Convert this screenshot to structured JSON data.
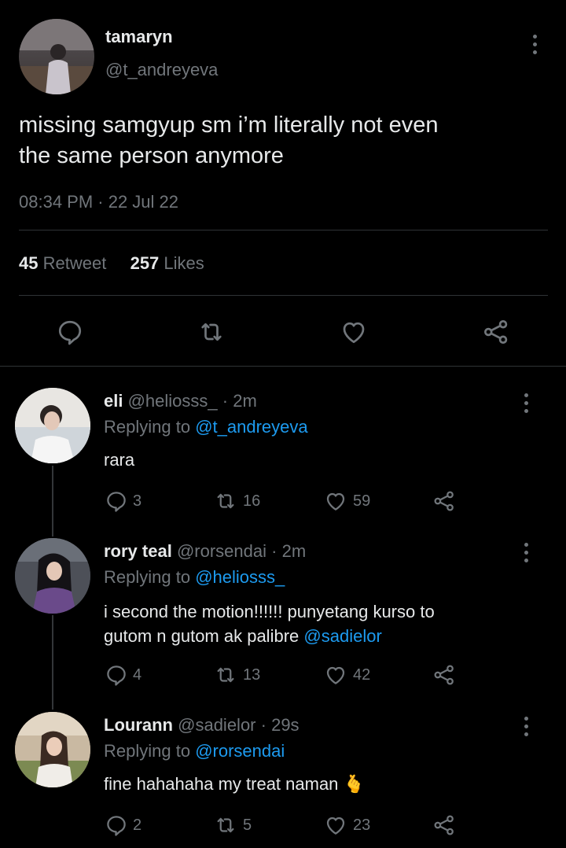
{
  "main_tweet": {
    "display_name": "tamaryn",
    "handle": "@t_andreyeva",
    "text_line1": "missing samgyup sm i’m literally not even",
    "text_line2": "the same person anymore",
    "timestamp": "08:34 PM · 22 Jul 22",
    "retweet_count": "45",
    "retweet_label": "Retweet",
    "like_count": "257",
    "like_label": "Likes"
  },
  "replies": [
    {
      "display_name": "eli",
      "handle": "@heliosss_",
      "time": "· 2m",
      "replying_label": "Replying to",
      "replying_to": "@t_andreyeva",
      "text_line1": "rara",
      "text_line2": "",
      "mention": "",
      "reply_count": "3",
      "retweet_count": "16",
      "like_count": "59"
    },
    {
      "display_name": "rory teal",
      "handle": "@rorsendai",
      "time": "· 2m",
      "replying_label": "Replying to",
      "replying_to": "@heliosss_",
      "text_line1": "i second the motion!!!!!! punyetang kurso to",
      "text_line2": "gutom n gutom ak palibre",
      "mention": "@sadielor",
      "reply_count": "4",
      "retweet_count": "13",
      "like_count": "42"
    },
    {
      "display_name": "Lourann",
      "handle": "@sadielor",
      "time": "· 29s",
      "replying_label": "Replying to",
      "replying_to": "@rorsendai",
      "text_line1": "fine hahahaha my treat naman",
      "emoji": "🫰",
      "reply_count": "2",
      "retweet_count": "5",
      "like_count": "23"
    }
  ],
  "icons": {
    "reply": "reply-icon",
    "retweet": "retweet-icon",
    "like": "heart-icon",
    "share": "share-icon",
    "more": "more-options-icon"
  },
  "colors": {
    "background": "#000000",
    "text": "#e7e9ea",
    "muted": "#71767b",
    "link": "#1d9bf0",
    "divider": "#2f3336"
  }
}
